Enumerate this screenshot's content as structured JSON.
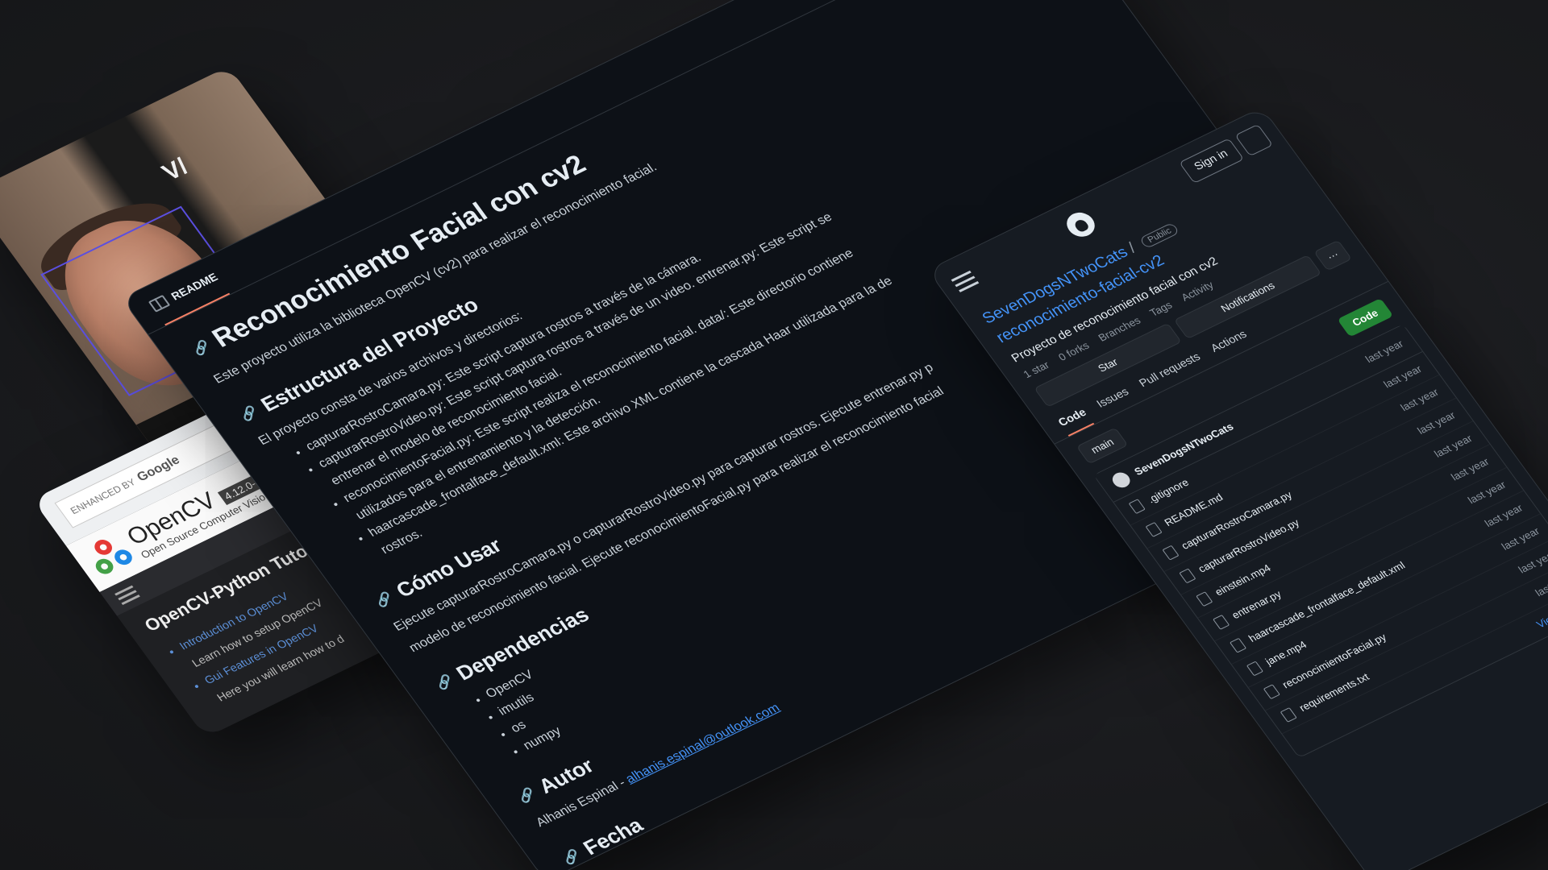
{
  "photo": {
    "logo_text": "V/"
  },
  "opencv": {
    "search_prefix": "ENHANCED BY",
    "search_brand": "Google",
    "name": "OpenCV",
    "version": "4.12.0-de",
    "tagline": "Open Source Computer Visio",
    "title": "OpenCV-Python Tutor",
    "items": [
      {
        "text": "Introduction to OpenCV",
        "kind": "link"
      },
      {
        "text": "Learn how to setup OpenCV",
        "kind": "text"
      },
      {
        "text": "Gui Features in OpenCV",
        "kind": "link"
      },
      {
        "text": "Here you will learn how to d",
        "kind": "text"
      }
    ]
  },
  "readme": {
    "tab_label": "README",
    "title": "Reconocimiento Facial con cv2",
    "intro": "Este proyecto utiliza la biblioteca OpenCV (cv2) para realizar el reconocimiento facial.",
    "structure_heading": "Estructura del Proyecto",
    "structure_intro": "El proyecto consta de varios archivos y directorios:",
    "structure_items": [
      "capturarRostroCamara.py: Este script captura rostros a través de la cámara.",
      "capturarRostroVideo.py: Este script captura rostros a través de un video. entrenar.py: Este script se",
      "entrenar el modelo de reconocimiento facial.",
      "reconocimientoFacial.py: Este script realiza el reconocimiento facial. data/: Este directorio contiene",
      "utilizados para el entrenamiento y la detección.",
      "haarcascade_frontalface_default.xml: Este archivo XML contiene la cascada Haar utilizada para la de",
      "rostros."
    ],
    "usage_heading": "Cómo Usar",
    "usage_line1": "Ejecute capturarRostroCamara.py o capturarRostroVideo.py para capturar rostros. Ejecute entrenar.py p",
    "usage_line2": "modelo de reconocimiento facial. Ejecute reconocimientoFacial.py para realizar el reconocimiento facial",
    "deps_heading": "Dependencias",
    "deps": [
      "OpenCV",
      "imutils",
      "os",
      "numpy"
    ],
    "author_heading": "Autor",
    "author_name": "Alhanis Espinal -",
    "author_email": "alhanis.espinal@outlook.com",
    "date_heading": "Fecha"
  },
  "repo": {
    "sign_in": "Sign in",
    "owner": "SevenDogsNTwoCats",
    "sep": "/",
    "name": "reconocimiento-facial-cv2",
    "visibility": "Public",
    "description": "Proyecto de reconocimiento facial con cv2",
    "meta": [
      "1 star",
      "0 forks",
      "Branches",
      "Tags",
      "Activity"
    ],
    "star_label": "Star",
    "notifications_label": "Notifications",
    "more_label": "···",
    "tabs": [
      "Code",
      "Issues",
      "Pull requests",
      "Actions"
    ],
    "branch": "main",
    "code_button": "Code",
    "commit_author": "SevenDogsNTwoCats",
    "commit_time": "last year",
    "files": [
      {
        "name": ".gitignore",
        "time": "last year"
      },
      {
        "name": "README.md",
        "time": "last year"
      },
      {
        "name": "capturarRostroCamara.py",
        "time": "last year"
      },
      {
        "name": "capturarRostroVideo.py",
        "time": "last year"
      },
      {
        "name": "einstein.mp4",
        "time": "last year"
      },
      {
        "name": "entrenar.py",
        "time": "last year"
      },
      {
        "name": "haarcascade_frontalface_default.xml",
        "time": "last year"
      },
      {
        "name": "jane.mp4",
        "time": "last year"
      },
      {
        "name": "reconocimientoFacial.py",
        "time": "last year"
      },
      {
        "name": "requirements.txt",
        "time": "last year"
      }
    ],
    "view_all": "View all files"
  }
}
